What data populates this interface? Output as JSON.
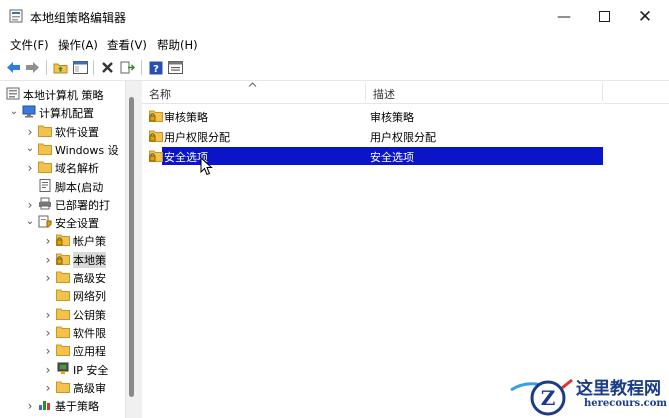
{
  "window": {
    "title": "本地组策略编辑器"
  },
  "menu": [
    "文件(F)",
    "操作(A)",
    "查看(V)",
    "帮助(H)"
  ],
  "tree": [
    {
      "label": "本地计算机 策略",
      "icon": "computer-policy-icon",
      "expander": "",
      "indent": 0
    },
    {
      "label": "计算机配置",
      "icon": "computer-icon",
      "expander": "v",
      "indent": 1
    },
    {
      "label": "软件设置",
      "icon": "folder-icon",
      "expander": ">",
      "indent": 2
    },
    {
      "label": "Windows 设",
      "icon": "folder-icon",
      "expander": "v",
      "indent": 2
    },
    {
      "label": "域名解析",
      "icon": "folder-icon",
      "expander": ">",
      "indent": 3
    },
    {
      "label": "脚本(启动",
      "icon": "script-icon",
      "expander": "",
      "indent": 3
    },
    {
      "label": "已部署的打",
      "icon": "printer-icon",
      "expander": ">",
      "indent": 3
    },
    {
      "label": "安全设置",
      "icon": "security-settings-icon",
      "expander": "v",
      "indent": 3
    },
    {
      "label": "帐户策",
      "icon": "lock-folder-icon",
      "expander": ">",
      "indent": 4
    },
    {
      "label": "本地策",
      "icon": "lock-folder-icon",
      "expander": ">",
      "indent": 4,
      "selected": true
    },
    {
      "label": "高级安",
      "icon": "folder-icon",
      "expander": ">",
      "indent": 4
    },
    {
      "label": "网络列",
      "icon": "folder-icon",
      "expander": "",
      "indent": 4
    },
    {
      "label": "公钥策",
      "icon": "folder-icon",
      "expander": ">",
      "indent": 4
    },
    {
      "label": "软件限",
      "icon": "folder-icon",
      "expander": ">",
      "indent": 4
    },
    {
      "label": "应用程",
      "icon": "folder-icon",
      "expander": ">",
      "indent": 4
    },
    {
      "label": "IP 安全",
      "icon": "ip-security-icon",
      "expander": ">",
      "indent": 4
    },
    {
      "label": "高级审",
      "icon": "folder-icon",
      "expander": ">",
      "indent": 4
    },
    {
      "label": "基于策略",
      "icon": "chart-icon",
      "expander": ">",
      "indent": 3
    }
  ],
  "list": {
    "columns": [
      "名称",
      "描述"
    ],
    "rows": [
      {
        "name": "审核策略",
        "desc": "审核策略"
      },
      {
        "name": "用户权限分配",
        "desc": "用户权限分配"
      },
      {
        "name": "安全选项",
        "desc": "安全选项",
        "selected": true
      }
    ]
  },
  "watermark": {
    "title": "这里教程网",
    "url": "herecours.com"
  },
  "colors": {
    "selection": "#0a14c8",
    "folder": "#f3c24a",
    "watermark": "#1a3a8a"
  }
}
